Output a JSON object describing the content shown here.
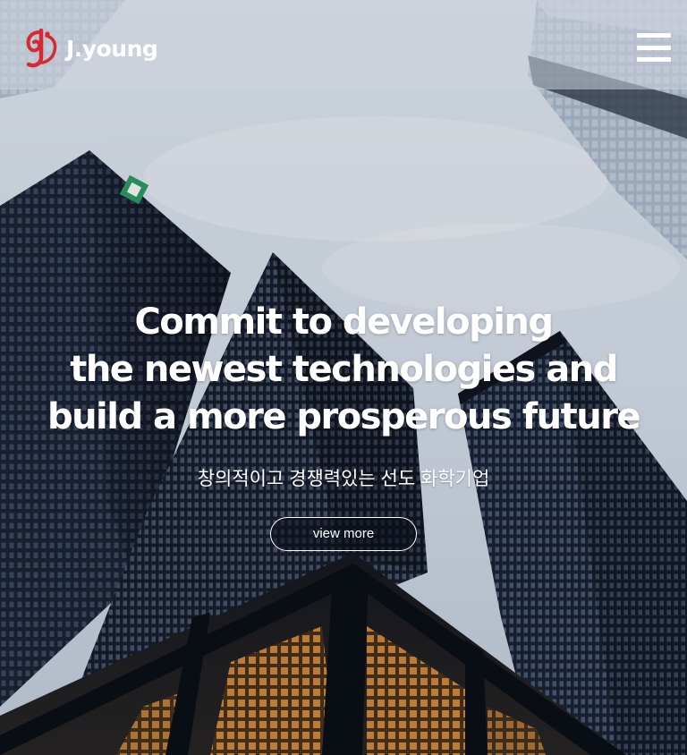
{
  "brand": {
    "name": "J.young",
    "logo_icon": "jy-monogram-logo",
    "logo_color": "#d42a34"
  },
  "header": {
    "menu_icon": "hamburger-menu-icon"
  },
  "hero": {
    "title_lines": [
      "Commit to developing",
      "the newest technologies and",
      "build a more prosperous future"
    ],
    "subtitle": "창의적이고 경쟁력있는 선도 화학기업",
    "cta_label": "view more"
  }
}
